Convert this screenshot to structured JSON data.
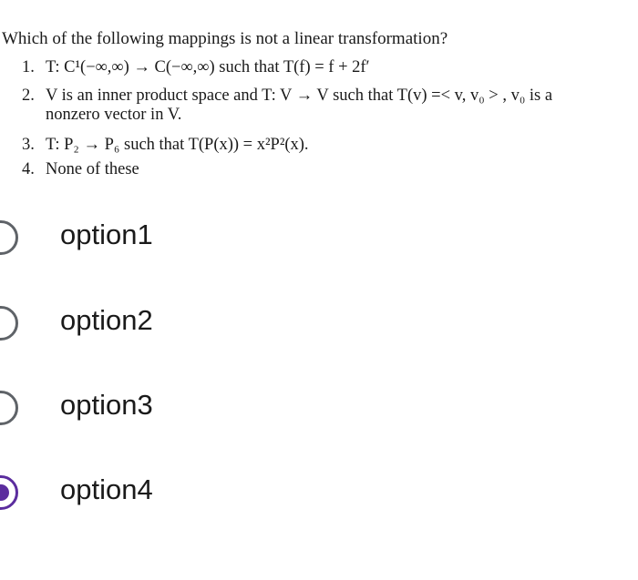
{
  "question": {
    "text": "Which of the following mappings is not a linear transformation?",
    "items": [
      {
        "num": "1.",
        "line1": "T: C¹(−∞,∞) → C(−∞,∞) such that T(f) = f + 2f′",
        "line2": ""
      },
      {
        "num": "2.",
        "line1": "V is an inner product space and T: V → V such that T(v) =< v, v₀ > , v₀ is a",
        "line2": "nonzero vector in V."
      },
      {
        "num": "3.",
        "line1": "T: P₂ → P₆ such that T(P(x)) = x²P²(x).",
        "line2": ""
      },
      {
        "num": "4.",
        "line1": "None of these",
        "line2": ""
      }
    ]
  },
  "options": [
    {
      "label": "option1",
      "selected": false
    },
    {
      "label": "option2",
      "selected": false
    },
    {
      "label": "option3",
      "selected": false
    },
    {
      "label": "option4",
      "selected": true
    }
  ],
  "colors": {
    "radio_selected": "#5b2d9e",
    "radio_unselected": "#5f6368"
  }
}
